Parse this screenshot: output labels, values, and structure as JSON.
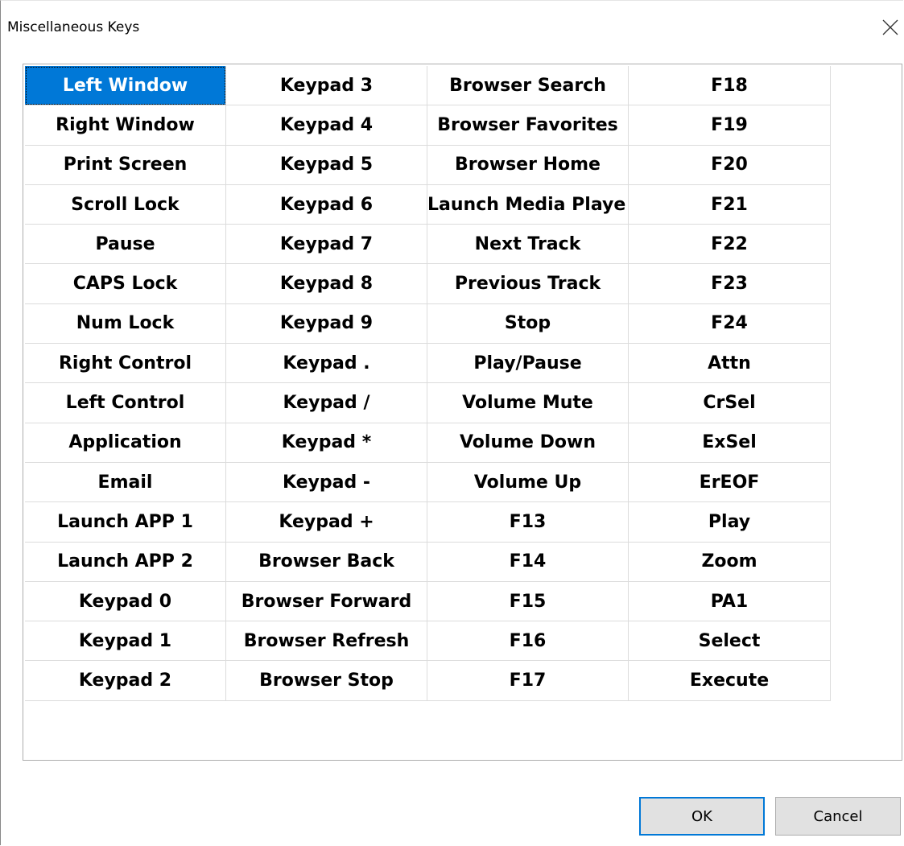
{
  "window": {
    "title": "Miscellaneous Keys"
  },
  "keys": {
    "rows": [
      [
        "Left Window",
        "Keypad 3",
        "Browser Search",
        "F18"
      ],
      [
        "Right Window",
        "Keypad 4",
        "Browser Favorites",
        "F19"
      ],
      [
        "Print Screen",
        "Keypad 5",
        "Browser Home",
        "F20"
      ],
      [
        "Scroll Lock",
        "Keypad 6",
        "Launch Media Playe",
        "F21"
      ],
      [
        "Pause",
        "Keypad 7",
        "Next Track",
        "F22"
      ],
      [
        "CAPS Lock",
        "Keypad 8",
        "Previous Track",
        "F23"
      ],
      [
        "Num Lock",
        "Keypad 9",
        "Stop",
        "F24"
      ],
      [
        "Right Control",
        "Keypad .",
        "Play/Pause",
        "Attn"
      ],
      [
        "Left Control",
        "Keypad /",
        "Volume Mute",
        "CrSel"
      ],
      [
        "Application",
        "Keypad *",
        "Volume Down",
        "ExSel"
      ],
      [
        "Email",
        "Keypad -",
        "Volume Up",
        "ErEOF"
      ],
      [
        "Launch APP 1",
        "Keypad +",
        "F13",
        "Play"
      ],
      [
        "Launch APP 2",
        "Browser Back",
        "F14",
        "Zoom"
      ],
      [
        "Keypad 0",
        "Browser Forward",
        "F15",
        "PA1"
      ],
      [
        "Keypad 1",
        "Browser Refresh",
        "F16",
        "Select"
      ],
      [
        "Keypad 2",
        "Browser Stop",
        "F17",
        "Execute"
      ]
    ],
    "selected": "Left Window"
  },
  "buttons": {
    "ok_label": "OK",
    "cancel_label": "Cancel"
  },
  "icons": {
    "close": "close-icon"
  },
  "colors": {
    "selection": "#0078d7",
    "button_face": "#e1e1e1",
    "default_button_border": "#0078d7"
  }
}
